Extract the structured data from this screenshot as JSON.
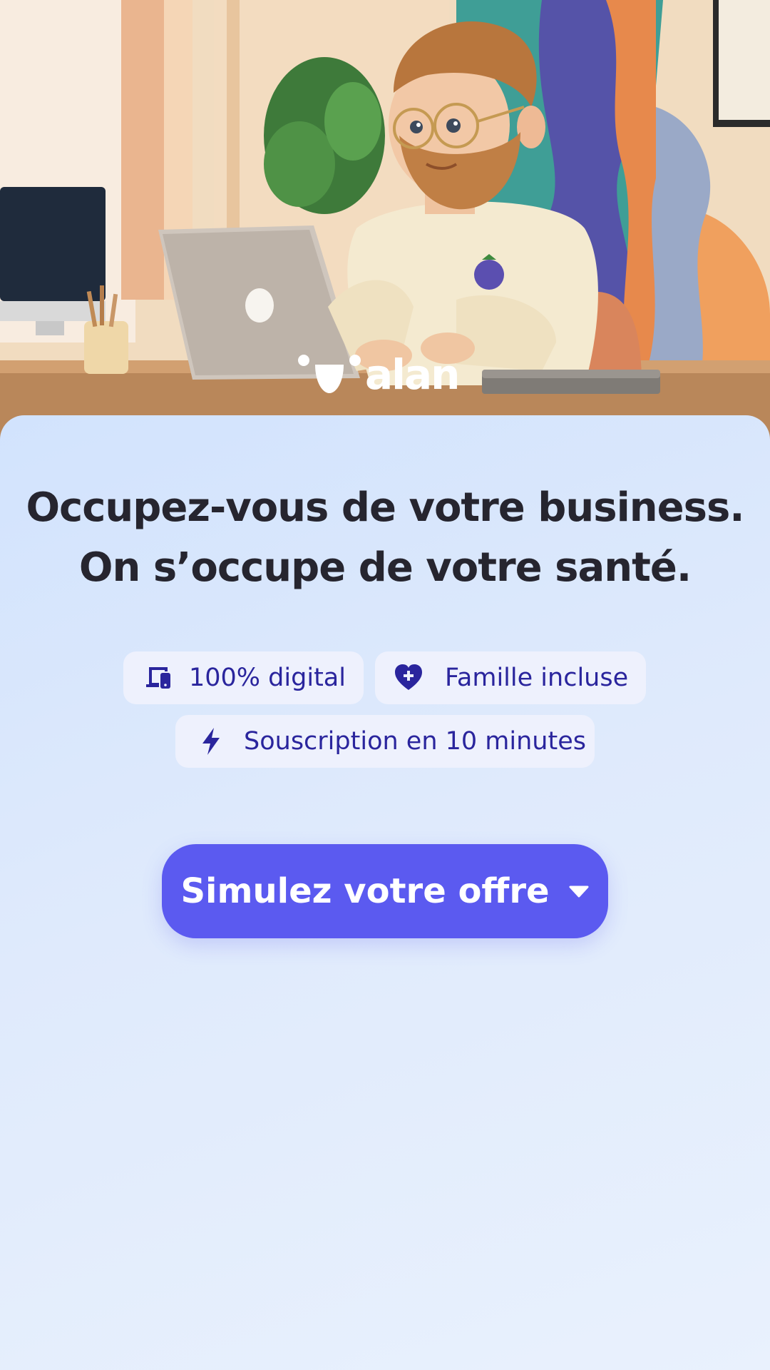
{
  "brand": {
    "name": "alan"
  },
  "hero": {
    "illustration": "3d-man-working-on-laptop-at-desk",
    "colors": {
      "wall": "#f1dcc0",
      "sweater": "#f4ead0",
      "panel_purple": "#5553a8",
      "panel_teal": "#3f9e96",
      "panel_orange": "#e7894c"
    }
  },
  "headline": {
    "line1": "Occupez-vous de votre business.",
    "line2": "On s’occupe de votre santé."
  },
  "features": [
    {
      "icon": "devices-icon",
      "label": "100% digital"
    },
    {
      "icon": "heart-plus-icon",
      "label": "Famille incluse"
    },
    {
      "icon": "lightning-icon",
      "label": "Souscription en 10 minutes"
    }
  ],
  "cta": {
    "label": "Simulez votre offre",
    "icon": "caret-down-icon",
    "color": "#5b5af0"
  },
  "theme": {
    "chip_bg": "#eef1fd",
    "chip_text": "#2a259d",
    "headline_text": "#26252f",
    "panel_bg": "#dbe8fc"
  }
}
